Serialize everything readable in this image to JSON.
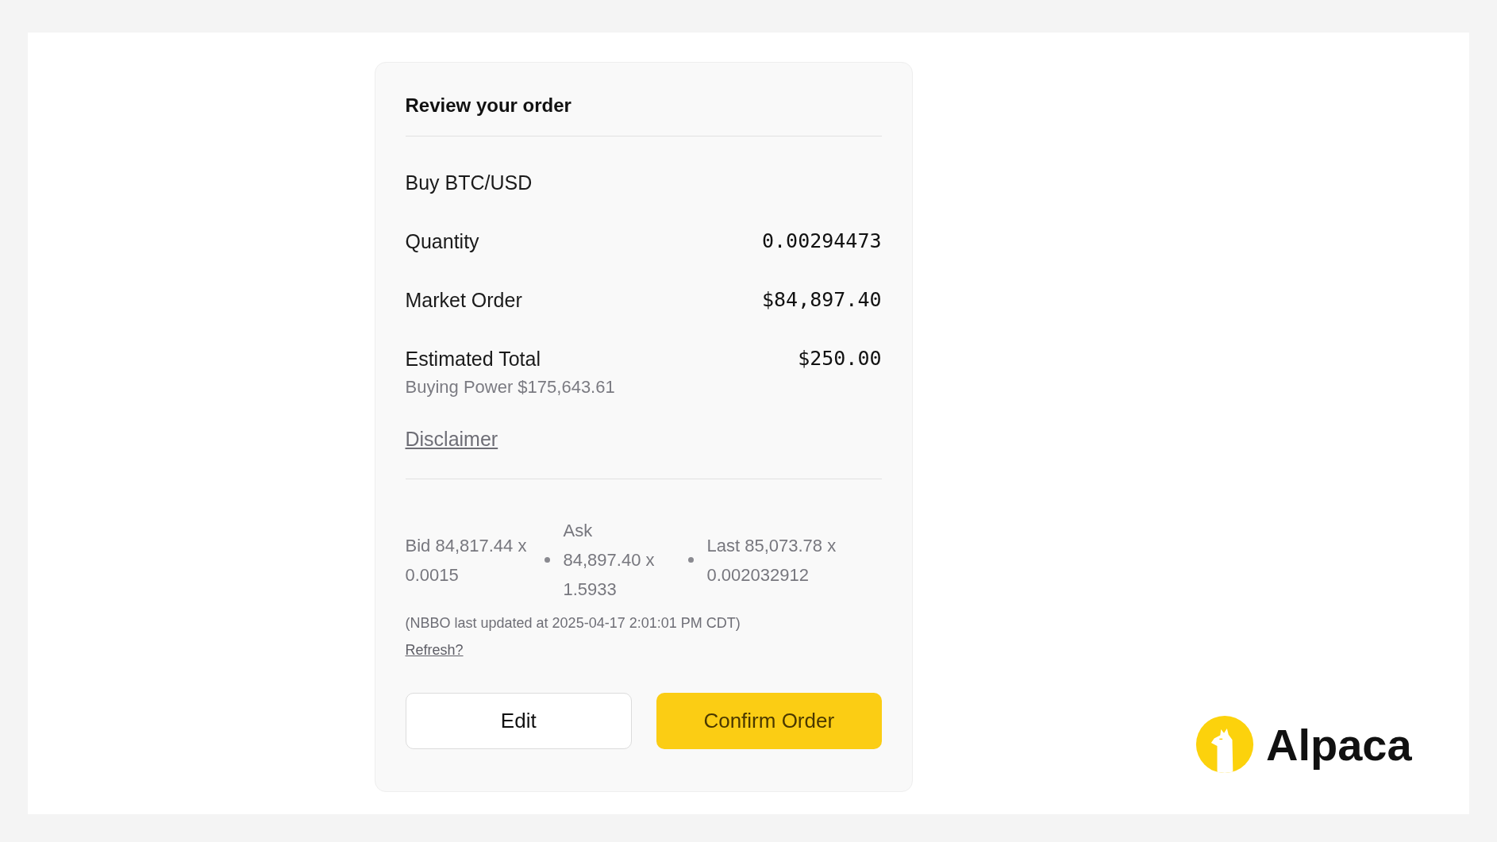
{
  "title": "Review your order",
  "heading": "Buy BTC/USD",
  "rows": [
    {
      "label": "Quantity",
      "value": "0.00294473"
    },
    {
      "label": "Market Order",
      "value": "$84,897.40"
    },
    {
      "label": "Estimated Total",
      "value": "$250.00"
    }
  ],
  "buying_power": "Buying Power $175,643.61",
  "disclaimer_link": "Disclaimer",
  "quotes": [
    "Bid 84,817.44 x 0.0015",
    "Ask 84,897.40 x 1.5933",
    "Last 85,073.78 x 0.002032912"
  ],
  "nbbo_note": "(NBBO last updated at 2025-04-17 2:01:01 PM CDT)",
  "refresh_link": "Refresh?",
  "buttons": [
    {
      "label": "Edit",
      "kind": "secondary"
    },
    {
      "label": "Confirm Order",
      "kind": "primary"
    }
  ],
  "brand": "Alpaca"
}
